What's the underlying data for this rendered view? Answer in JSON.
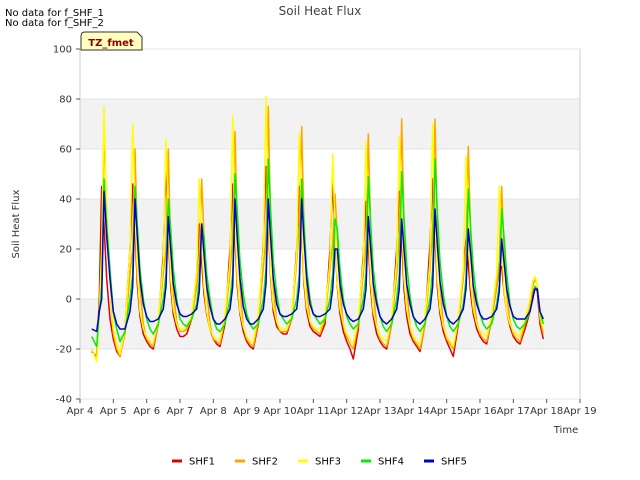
{
  "notes": [
    "No data for f_SHF_1",
    "No data for f_SHF_2"
  ],
  "tag_label": "TZ_fmet",
  "chart_data": {
    "type": "line",
    "title": "Soil Heat Flux",
    "xlabel": "Time",
    "ylabel": "Soil Heat Flux",
    "ylim": [
      -40,
      100
    ],
    "yticks": [
      -40,
      -20,
      0,
      20,
      40,
      60,
      80,
      100
    ],
    "xlim": [
      4,
      19
    ],
    "xticks": [
      4,
      5,
      6,
      7,
      8,
      9,
      10,
      11,
      12,
      13,
      14,
      15,
      16,
      17,
      18,
      19
    ],
    "xtick_labels": [
      "Apr 4",
      "Apr 5",
      "Apr 6",
      "Apr 7",
      "Apr 8",
      "Apr 9",
      "Apr 10",
      "Apr 11",
      "Apr 12",
      "Apr 13",
      "Apr 14",
      "Apr 15",
      "Apr 16",
      "Apr 17",
      "Apr 18",
      "Apr 19"
    ],
    "background_bands": "alternating light grey horizontal bands",
    "legend_position": "bottom-center",
    "x": [
      4.35,
      4.5,
      4.58,
      4.65,
      4.72,
      4.8,
      4.9,
      5.0,
      5.1,
      5.2,
      5.35,
      5.5,
      5.58,
      5.65,
      5.72,
      5.8,
      5.9,
      6.0,
      6.1,
      6.2,
      6.35,
      6.5,
      6.58,
      6.65,
      6.72,
      6.8,
      6.9,
      7.0,
      7.1,
      7.2,
      7.35,
      7.5,
      7.58,
      7.65,
      7.72,
      7.8,
      7.9,
      8.0,
      8.1,
      8.2,
      8.35,
      8.5,
      8.58,
      8.65,
      8.72,
      8.8,
      8.9,
      9.0,
      9.1,
      9.2,
      9.35,
      9.5,
      9.58,
      9.65,
      9.72,
      9.8,
      9.9,
      10.0,
      10.1,
      10.2,
      10.35,
      10.5,
      10.58,
      10.65,
      10.72,
      10.8,
      10.9,
      11.0,
      11.1,
      11.2,
      11.35,
      11.5,
      11.58,
      11.65,
      11.72,
      11.8,
      11.9,
      12.0,
      12.1,
      12.2,
      12.35,
      12.5,
      12.58,
      12.65,
      12.72,
      12.8,
      12.9,
      13.0,
      13.1,
      13.2,
      13.35,
      13.5,
      13.58,
      13.65,
      13.72,
      13.8,
      13.9,
      14.0,
      14.1,
      14.2,
      14.35,
      14.5,
      14.58,
      14.65,
      14.72,
      14.8,
      14.9,
      15.0,
      15.1,
      15.2,
      15.35,
      15.5,
      15.58,
      15.65,
      15.72,
      15.8,
      15.9,
      16.0,
      16.1,
      16.2,
      16.35,
      16.5,
      16.58,
      16.65,
      16.72,
      16.8,
      16.9,
      17.0,
      17.1,
      17.2,
      17.35,
      17.5,
      17.58,
      17.65,
      17.72,
      17.8,
      17.9,
      18.0,
      18.1,
      18.2,
      18.3
    ],
    "series": [
      {
        "name": "SHF1",
        "color": "#dd0000",
        "values": [
          -21,
          -23,
          0,
          45,
          30,
          8,
          -8,
          -16,
          -21,
          -23,
          -12,
          20,
          46,
          28,
          6,
          -7,
          -14,
          -17,
          -19,
          -20,
          -10,
          18,
          54,
          25,
          5,
          -6,
          -12,
          -15,
          -15,
          -14,
          -8,
          10,
          30,
          15,
          2,
          -6,
          -12,
          -16,
          -18,
          -19,
          -10,
          20,
          46,
          25,
          5,
          -6,
          -13,
          -17,
          -19,
          -20,
          -10,
          22,
          53,
          30,
          8,
          -5,
          -11,
          -13,
          -14,
          -14,
          -8,
          20,
          45,
          26,
          6,
          -5,
          -11,
          -13,
          -14,
          -15,
          -10,
          20,
          47,
          25,
          5,
          -6,
          -13,
          -17,
          -20,
          -24,
          -12,
          18,
          39,
          22,
          4,
          -7,
          -14,
          -17,
          -19,
          -20,
          -10,
          20,
          43,
          24,
          4,
          -7,
          -14,
          -17,
          -19,
          -21,
          -10,
          22,
          48,
          26,
          5,
          -6,
          -13,
          -17,
          -20,
          -23,
          -10,
          10,
          24,
          14,
          2,
          -6,
          -12,
          -15,
          -17,
          -18,
          -8,
          5,
          12,
          13,
          3,
          -5,
          -11,
          -15,
          -17,
          -18,
          -12,
          -5,
          2,
          5,
          3,
          -10,
          -16
        ]
      },
      {
        "name": "SHF2",
        "color": "#ffa500",
        "values": [
          -20,
          -24,
          -5,
          10,
          70,
          30,
          8,
          -14,
          -20,
          -23,
          -14,
          10,
          20,
          60,
          25,
          5,
          -10,
          -16,
          -18,
          -19,
          -10,
          10,
          20,
          60,
          20,
          3,
          -9,
          -13,
          -13,
          -12,
          -8,
          5,
          15,
          48,
          25,
          4,
          -10,
          -16,
          -17,
          -18,
          -8,
          10,
          25,
          67,
          28,
          5,
          -11,
          -16,
          -18,
          -19,
          -9,
          12,
          25,
          77,
          30,
          5,
          -9,
          -13,
          -13,
          -13,
          -8,
          15,
          30,
          69,
          30,
          5,
          -9,
          -12,
          -13,
          -14,
          -8,
          12,
          22,
          42,
          25,
          3,
          -10,
          -15,
          -18,
          -20,
          -10,
          10,
          22,
          66,
          28,
          4,
          -11,
          -16,
          -18,
          -19,
          -10,
          10,
          25,
          72,
          30,
          5,
          -11,
          -16,
          -18,
          -20,
          -10,
          12,
          28,
          72,
          30,
          5,
          -10,
          -16,
          -18,
          -20,
          -9,
          8,
          20,
          61,
          25,
          3,
          -9,
          -14,
          -16,
          -17,
          -8,
          5,
          15,
          45,
          20,
          2,
          -9,
          -14,
          -16,
          -17,
          -10,
          -3,
          5,
          8,
          6,
          -8,
          -14
        ]
      },
      {
        "name": "SHF3",
        "color": "#ffff00",
        "values": [
          -20,
          -25,
          -5,
          20,
          77,
          35,
          10,
          -12,
          -18,
          -22,
          -12,
          20,
          70,
          35,
          10,
          -5,
          -12,
          -15,
          -17,
          -17,
          -8,
          15,
          64,
          30,
          8,
          -4,
          -10,
          -12,
          -12,
          -11,
          -6,
          10,
          48,
          22,
          5,
          -5,
          -12,
          -15,
          -16,
          -16,
          -6,
          15,
          73,
          30,
          8,
          -5,
          -11,
          -15,
          -17,
          -17,
          -6,
          20,
          81,
          35,
          10,
          -3,
          -9,
          -12,
          -12,
          -12,
          -6,
          18,
          66,
          30,
          8,
          -3,
          -9,
          -11,
          -12,
          -12,
          -6,
          15,
          58,
          28,
          6,
          -4,
          -10,
          -14,
          -16,
          -18,
          -8,
          15,
          63,
          30,
          7,
          -5,
          -11,
          -15,
          -16,
          -17,
          -7,
          15,
          65,
          32,
          8,
          -4,
          -11,
          -15,
          -17,
          -18,
          -7,
          15,
          70,
          32,
          8,
          -4,
          -11,
          -15,
          -17,
          -19,
          -7,
          12,
          57,
          28,
          6,
          -4,
          -10,
          -13,
          -14,
          -15,
          -6,
          10,
          45,
          22,
          4,
          -5,
          -10,
          -13,
          -14,
          -15,
          -8,
          0,
          7,
          9,
          6,
          -6,
          -12
        ]
      },
      {
        "name": "SHF4",
        "color": "#00ee00",
        "values": [
          -15,
          -19,
          -5,
          5,
          48,
          30,
          12,
          -5,
          -12,
          -17,
          -13,
          0,
          10,
          45,
          30,
          12,
          0,
          -8,
          -12,
          -14,
          -10,
          0,
          10,
          40,
          28,
          12,
          0,
          -8,
          -10,
          -11,
          -8,
          -2,
          8,
          30,
          25,
          10,
          0,
          -8,
          -12,
          -13,
          -10,
          0,
          10,
          50,
          35,
          15,
          2,
          -6,
          -10,
          -12,
          -10,
          0,
          12,
          56,
          35,
          15,
          2,
          -6,
          -8,
          -10,
          -8,
          0,
          10,
          48,
          30,
          12,
          0,
          -6,
          -8,
          -10,
          -8,
          0,
          10,
          32,
          28,
          12,
          0,
          -7,
          -10,
          -12,
          -10,
          0,
          10,
          49,
          30,
          12,
          0,
          -7,
          -11,
          -13,
          -10,
          0,
          10,
          51,
          32,
          14,
          1,
          -7,
          -11,
          -13,
          -10,
          0,
          12,
          56,
          35,
          15,
          2,
          -7,
          -11,
          -13,
          -10,
          -2,
          8,
          44,
          28,
          12,
          0,
          -6,
          -10,
          -12,
          -10,
          -2,
          6,
          36,
          25,
          10,
          -2,
          -8,
          -11,
          -12,
          -10,
          -5,
          0,
          5,
          4,
          -5,
          -10
        ]
      },
      {
        "name": "SHF5",
        "color": "#0000cc",
        "values": [
          -12,
          -13,
          -5,
          0,
          43,
          25,
          8,
          -5,
          -10,
          -12,
          -12,
          -5,
          5,
          40,
          25,
          8,
          -2,
          -7,
          -9,
          -9,
          -8,
          -4,
          5,
          33,
          20,
          6,
          -2,
          -6,
          -7,
          -7,
          -6,
          -4,
          3,
          30,
          18,
          5,
          -3,
          -8,
          -10,
          -10,
          -8,
          -4,
          5,
          40,
          24,
          8,
          -3,
          -8,
          -10,
          -10,
          -8,
          -4,
          6,
          40,
          24,
          8,
          -2,
          -6,
          -7,
          -7,
          -6,
          -4,
          5,
          40,
          24,
          8,
          -2,
          -6,
          -7,
          -7,
          -6,
          -4,
          4,
          20,
          20,
          6,
          -2,
          -6,
          -8,
          -9,
          -8,
          -4,
          4,
          33,
          20,
          6,
          -2,
          -7,
          -9,
          -10,
          -8,
          -4,
          4,
          32,
          20,
          6,
          -2,
          -7,
          -9,
          -10,
          -8,
          -4,
          5,
          36,
          22,
          7,
          -2,
          -7,
          -9,
          -10,
          -8,
          -4,
          4,
          28,
          18,
          5,
          -2,
          -6,
          -8,
          -8,
          -7,
          -4,
          3,
          24,
          15,
          4,
          -3,
          -7,
          -8,
          -8,
          -8,
          -5,
          0,
          4,
          4,
          -5,
          -8
        ]
      }
    ]
  }
}
